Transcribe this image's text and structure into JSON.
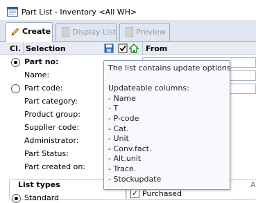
{
  "window": {
    "title": "Part List - Inventory  <All WH>"
  },
  "tabs": [
    {
      "label": "Create",
      "active": true
    },
    {
      "label": "Display List",
      "active": false
    },
    {
      "label": "Preview",
      "active": false
    }
  ],
  "grid_header": {
    "cl": "Cl.",
    "selection": "Selection",
    "from": "From",
    "icons": [
      "save-icon",
      "checkbox-icon",
      "house-icon"
    ]
  },
  "form": {
    "rows": [
      {
        "label": "Part no:",
        "radio": true,
        "checked": true,
        "bold": true
      },
      {
        "label": "Name:"
      },
      {
        "label": "Part code:",
        "radio": true,
        "checked": false
      },
      {
        "label": "Part category:"
      },
      {
        "label": "Product group:"
      },
      {
        "label": "Supplier code:"
      },
      {
        "label": "Administrator:"
      },
      {
        "label": "Part Status:"
      },
      {
        "label": "Part created on:"
      }
    ]
  },
  "list_types": {
    "title": "List types",
    "standard_label": "Standard"
  },
  "purchased": {
    "label": "Purchased",
    "checked": true
  },
  "side_letter": "A",
  "tooltip": {
    "line1": "The list contains update options",
    "header": "Updateable columns:",
    "columns": [
      "Name",
      "T",
      "P-code",
      "Cat.",
      "Unit",
      "Conv.fact.",
      "Alt.unit",
      "Trace.",
      "Stockupdate"
    ]
  },
  "colors": {
    "window_bg": "#e8eef7",
    "tab_strip": "#dfe6f1",
    "header_bg": "#e8ecf2",
    "tooltip_bg": "#f7f9fc",
    "accent_blue": "#2f6fbf"
  }
}
